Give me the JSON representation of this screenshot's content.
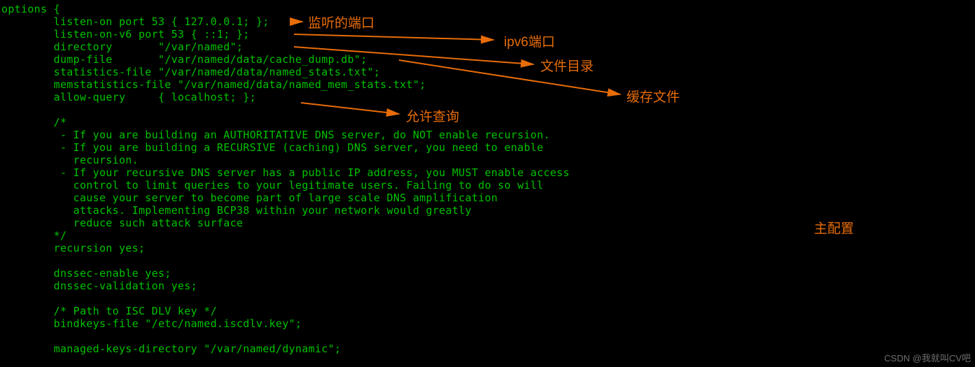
{
  "code": {
    "lines": [
      "options {",
      "        listen-on port 53 { 127.0.0.1; };",
      "        listen-on-v6 port 53 { ::1; };",
      "        directory       \"/var/named\";",
      "        dump-file       \"/var/named/data/cache_dump.db\";",
      "        statistics-file \"/var/named/data/named_stats.txt\";",
      "        memstatistics-file \"/var/named/data/named_mem_stats.txt\";",
      "        allow-query     { localhost; };",
      "",
      "        /*",
      "         - If you are building an AUTHORITATIVE DNS server, do NOT enable recursion.",
      "         - If you are building a RECURSIVE (caching) DNS server, you need to enable",
      "           recursion.",
      "         - If your recursive DNS server has a public IP address, you MUST enable access",
      "           control to limit queries to your legitimate users. Failing to do so will",
      "           cause your server to become part of large scale DNS amplification",
      "           attacks. Implementing BCP38 within your network would greatly",
      "           reduce such attack surface",
      "        */",
      "        recursion yes;",
      "",
      "        dnssec-enable yes;",
      "        dnssec-validation yes;",
      "",
      "        /* Path to ISC DLV key */",
      "        bindkeys-file \"/etc/named.iscdlv.key\";",
      "",
      "        managed-keys-directory \"/var/named/dynamic\";"
    ]
  },
  "annotations": {
    "listen_port": "监听的端口",
    "ipv6_port": "ipv6端口",
    "directory": "文件目录",
    "dump_file": "缓存文件",
    "allow_query": "允许查询",
    "main_config": "主配置"
  },
  "watermark": "CSDN @我就叫CV吧"
}
